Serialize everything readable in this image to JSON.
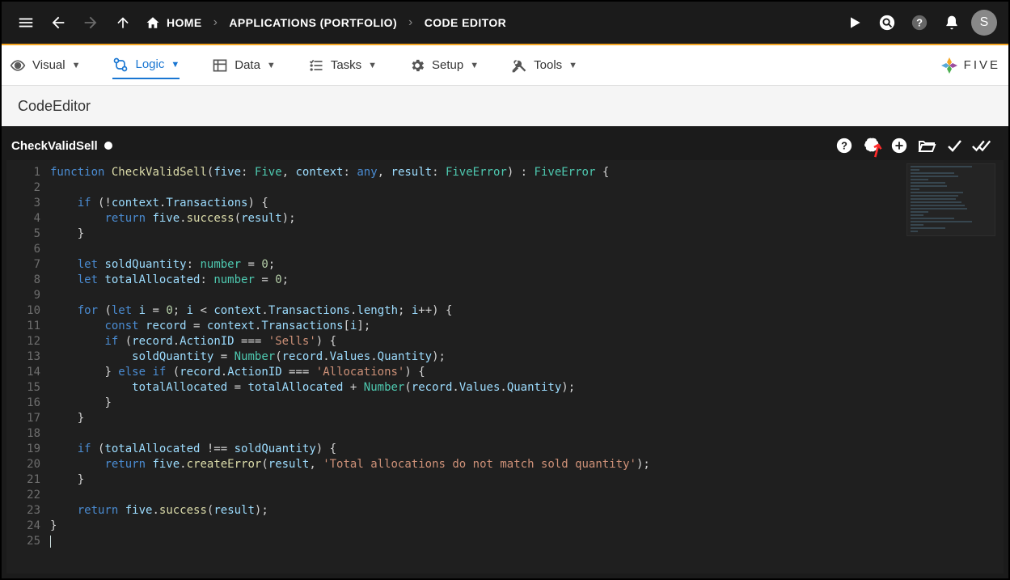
{
  "topbar": {
    "home": "HOME",
    "crumb_apps": "APPLICATIONS (PORTFOLIO)",
    "crumb_code": "CODE EDITOR",
    "avatar_letter": "S"
  },
  "toolbar": {
    "visual": "Visual",
    "logic": "Logic",
    "data": "Data",
    "tasks": "Tasks",
    "setup": "Setup",
    "tools": "Tools",
    "brand": "FIVE"
  },
  "subheader": {
    "title": "CodeEditor"
  },
  "editor": {
    "tab_name": "CheckValidSell",
    "line_numbers": [
      "1",
      "2",
      "3",
      "4",
      "5",
      "6",
      "7",
      "8",
      "9",
      "10",
      "11",
      "12",
      "13",
      "14",
      "15",
      "16",
      "17",
      "18",
      "19",
      "20",
      "21",
      "22",
      "23",
      "24",
      "25"
    ],
    "code": {
      "l1": {
        "a": "function",
        "b": " ",
        "c": "CheckValidSell",
        "d": "(",
        "e": "five",
        "f": ": ",
        "g": "Five",
        "h": ", ",
        "i": "context",
        "j": ": ",
        "k": "any",
        "l": ", ",
        "m": "result",
        "n": ": ",
        "o": "FiveError",
        "p": ") : ",
        "q": "FiveError",
        "r": " {"
      },
      "l3": {
        "ind": "    ",
        "a": "if",
        "b": " (!",
        "c": "context",
        "d": ".",
        "e": "Transactions",
        "f": ") {"
      },
      "l4": {
        "ind": "        ",
        "a": "return",
        "b": " ",
        "c": "five",
        "d": ".",
        "e": "success",
        "f": "(",
        "g": "result",
        "h": ");"
      },
      "l5": {
        "ind": "    ",
        "a": "}"
      },
      "l7": {
        "ind": "    ",
        "a": "let",
        "b": " ",
        "c": "soldQuantity",
        "d": ": ",
        "e": "number",
        "f": " = ",
        "g": "0",
        "h": ";"
      },
      "l8": {
        "ind": "    ",
        "a": "let",
        "b": " ",
        "c": "totalAllocated",
        "d": ": ",
        "e": "number",
        "f": " = ",
        "g": "0",
        "h": ";"
      },
      "l10": {
        "ind": "    ",
        "a": "for",
        "b": " (",
        "c": "let",
        "d": " ",
        "e": "i",
        "f": " = ",
        "g": "0",
        "h": "; ",
        "i": "i",
        "j": " < ",
        "k": "context",
        "l": ".",
        "m": "Transactions",
        "n": ".",
        "o": "length",
        "p": "; ",
        "q": "i",
        "r": "++) {"
      },
      "l11": {
        "ind": "        ",
        "a": "const",
        "b": " ",
        "c": "record",
        "d": " = ",
        "e": "context",
        "f": ".",
        "g": "Transactions",
        "h": "[",
        "i": "i",
        "j": "];"
      },
      "l12": {
        "ind": "        ",
        "a": "if",
        "b": " (",
        "c": "record",
        "d": ".",
        "e": "ActionID",
        "f": " === ",
        "g": "'Sells'",
        "h": ") {"
      },
      "l13": {
        "ind": "            ",
        "a": "soldQuantity",
        "b": " = ",
        "c": "Number",
        "d": "(",
        "e": "record",
        "f": ".",
        "g": "Values",
        "h": ".",
        "i": "Quantity",
        "j": ");"
      },
      "l14": {
        "ind": "        ",
        "a": "} ",
        "b": "else",
        "c": " ",
        "d": "if",
        "e": " (",
        "f": "record",
        "g": ".",
        "h": "ActionID",
        "i": " === ",
        "j": "'Allocations'",
        "k": ") {"
      },
      "l15": {
        "ind": "            ",
        "a": "totalAllocated",
        "b": " = ",
        "c": "totalAllocated",
        "d": " + ",
        "e": "Number",
        "f": "(",
        "g": "record",
        "h": ".",
        "i": "Values",
        "j": ".",
        "k": "Quantity",
        "l": ");"
      },
      "l16": {
        "ind": "        ",
        "a": "}"
      },
      "l17": {
        "ind": "    ",
        "a": "}"
      },
      "l19": {
        "ind": "    ",
        "a": "if",
        "b": " (",
        "c": "totalAllocated",
        "d": " !== ",
        "e": "soldQuantity",
        "f": ") {"
      },
      "l20": {
        "ind": "        ",
        "a": "return",
        "b": " ",
        "c": "five",
        "d": ".",
        "e": "createError",
        "f": "(",
        "g": "result",
        "h": ", ",
        "i": "'Total allocations do not match sold quantity'",
        "j": ");"
      },
      "l21": {
        "ind": "    ",
        "a": "}"
      },
      "l23": {
        "ind": "    ",
        "a": "return",
        "b": " ",
        "c": "five",
        "d": ".",
        "e": "success",
        "f": "(",
        "g": "result",
        "h": ");"
      },
      "l24": {
        "a": "}"
      }
    }
  }
}
